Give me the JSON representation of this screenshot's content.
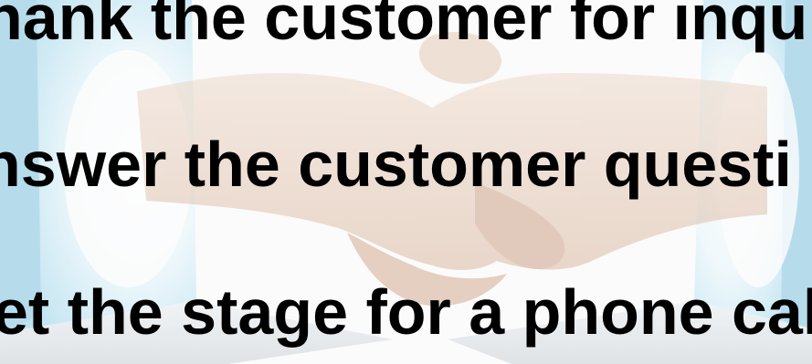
{
  "lines": [
    "hank the customer for inqu",
    "nswer the customer questi",
    "et the stage for a phone cal"
  ],
  "background_icon": "handshake-between-laptops-image",
  "colors": {
    "text": "#000000",
    "laptop_screen": "#9fd8ee",
    "skin": "#dcb59a"
  }
}
